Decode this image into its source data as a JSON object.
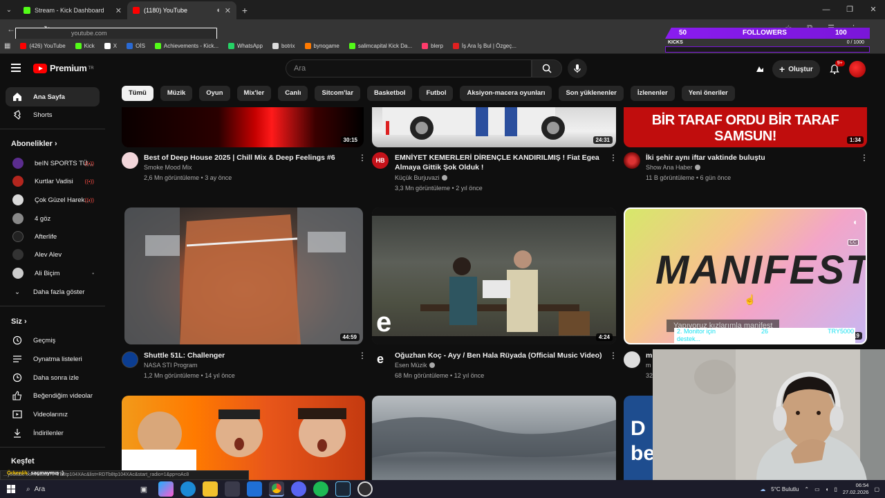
{
  "browser": {
    "tabs": [
      {
        "title": "Stream - Kick Dashboard",
        "color": "#53fc18",
        "active": false
      },
      {
        "title": "(1180) YouTube",
        "color": "#ff0000",
        "active": true
      }
    ],
    "new_tab": "+",
    "url": "youtube.com",
    "bookmarks": [
      {
        "label": "(426) YouTube",
        "color": "#ff0000"
      },
      {
        "label": "Kick",
        "color": "#53fc18"
      },
      {
        "label": "X",
        "color": "#ffffff"
      },
      {
        "label": "OİS",
        "color": "#2a6ad4"
      },
      {
        "label": "Achievements - Kick...",
        "color": "#53fc18"
      },
      {
        "label": "WhatsApp",
        "color": "#25d366"
      },
      {
        "label": "botrix",
        "color": "#dddddd"
      },
      {
        "label": "bynogame",
        "color": "#ff7a00"
      },
      {
        "label": "salimcapital Kick Da...",
        "color": "#53fc18"
      },
      {
        "label": "blerp",
        "color": "#ff3b6b"
      },
      {
        "label": "İş Ara İş Bul | Özgeç...",
        "color": "#e02020"
      }
    ]
  },
  "overlay": {
    "followers_count": "50",
    "followers_label": "FOLLOWERS",
    "followers_goal": "100",
    "kicks_label": "KICKS",
    "kicks_ratio": "0 / 1000"
  },
  "header": {
    "logo": "Premium",
    "logo_sup": "TR",
    "search_placeholder": "Ara",
    "create_label": "Oluştur",
    "notif_badge": "9+"
  },
  "chips": [
    "Tümü",
    "Müzik",
    "Oyun",
    "Mix'ler",
    "Canlı",
    "Sitcom'lar",
    "Basketbol",
    "Futbol",
    "Aksiyon-macera oyunları",
    "Son yüklenenler",
    "İzlenenler",
    "Yeni öneriler"
  ],
  "sidebar": {
    "home": "Ana Sayfa",
    "shorts": "Shorts",
    "subs_title": "Abonelikler",
    "subs": [
      {
        "label": "beIN SPORTS TÜ...",
        "color": "#5b2d8e",
        "live": true
      },
      {
        "label": "Kurtlar Vadisi",
        "color": "#b3261e",
        "live": true
      },
      {
        "label": "Çok Güzel Harek...",
        "color": "#d9d9d9",
        "live": true
      },
      {
        "label": "4 göz",
        "color": "#888888",
        "live": false
      },
      {
        "label": "Afterlife",
        "color": "#222222",
        "live": false
      },
      {
        "label": "Alev Alev",
        "color": "#333333",
        "live": false
      },
      {
        "label": "Ali Biçim",
        "color": "#cccccc",
        "live": false
      }
    ],
    "more": "Daha fazla göster",
    "you_title": "Siz",
    "you": [
      "Geçmiş",
      "Oynatma listeleri",
      "Daha sonra izle",
      "Beğendiğim videolar",
      "Videolarınız",
      "İndirilenler"
    ],
    "explore_title": "Keşfet"
  },
  "videos_row1": [
    {
      "title": "Best of Deep House 2025 | Chill Mix & Deep Feelings #6",
      "channel": "Smoke Mood Mix",
      "meta": "2,6 Mn görüntüleme • 3 ay önce",
      "duration": "30:15",
      "verified": false
    },
    {
      "title": "EMNİYET KEMERLERİ DİRENÇLE KANDIRILMIŞ ! Fiat Egea Almaya Gittik Şok Olduk !",
      "channel": "Küçük Burjuvazi",
      "meta": "3,3 Mn görüntüleme • 2 yıl önce",
      "duration": "24:31",
      "verified": true
    },
    {
      "title": "İki şehir aynı iftar vaktinde buluştu",
      "channel": "Show Ana Haber",
      "meta": "11 B görüntüleme • 6 gün önce",
      "duration": "1:34",
      "verified": true,
      "thumb_text": "BİR TARAF ORDU BİR TARAF SAMSUN!"
    }
  ],
  "videos_row2": [
    {
      "title": "Shuttle 51L: Challenger",
      "channel": "NASA STI Program",
      "meta": "1,2 Mn görüntüleme • 14 yıl önce",
      "duration": "44:59",
      "verified": false
    },
    {
      "title": "Oğuzhan Koç - Ayy / Ben Hala Rüyada  (Official Music Video)",
      "channel": "Esen Müzik",
      "meta": "68 Mn görüntüleme • 12 yıl önce",
      "duration": "4:24",
      "verified": true
    },
    {
      "title": "m",
      "channel": "m",
      "meta": "32",
      "duration": "19",
      "thumb_text": "MANIFEST",
      "caption": "Yapıyoruz kızlarımla manifest",
      "donation_text": "2. Monitor için destek...",
      "donation_count": "26",
      "donation_goal": "TRY5000"
    }
  ],
  "row3": {
    "thumb3_text": "D be"
  },
  "chat": {
    "user": "Örkenlik",
    "msg": ": saçmaymış :)"
  },
  "status_url": "...youtube.com/watch?v=Tb8tp104XAc&list=RDTb8tp104XAc&start_radio=1&pp=oAc8",
  "taskbar": {
    "search": "Ara",
    "weather": "5°C Bulutlu",
    "time": "06:54",
    "date": "27.02.2026"
  }
}
